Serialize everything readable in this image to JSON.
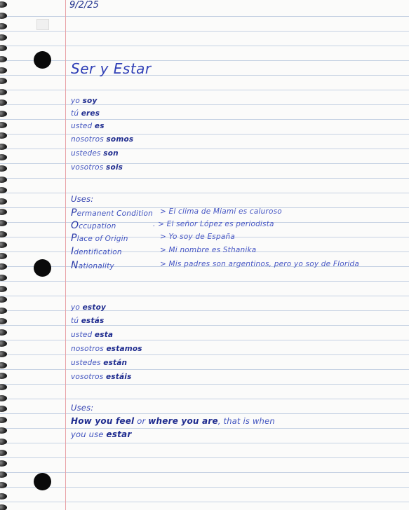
{
  "date": "9/2/25",
  "title": "Ser y Estar",
  "ser_conjugations": [
    {
      "subject": "yo",
      "verb": "soy"
    },
    {
      "subject": "tú",
      "verb": "eres"
    },
    {
      "subject": "usted",
      "verb": "es"
    },
    {
      "subject": "nosotros",
      "verb": "somos"
    },
    {
      "subject": "ustedes",
      "verb": "son"
    },
    {
      "subject": "vosotros",
      "verb": "sois"
    }
  ],
  "ser_uses_heading": "Uses:",
  "ser_uses": [
    {
      "term": "Permanent Condition",
      "example": "> El clima de Miami es caluroso"
    },
    {
      "term": "Occupation",
      "example": ". > El señor López es periodista"
    },
    {
      "term": "Place of Origin",
      "example": "> Yo soy de España"
    },
    {
      "term": "Identification",
      "example": "> Mi nombre es Sthanika"
    },
    {
      "term": "Nationality",
      "example": "> Mis padres son argentinos, pero yo soy de Florida"
    }
  ],
  "estar_conjugations": [
    {
      "subject": "yo",
      "verb": "estoy"
    },
    {
      "subject": "tú",
      "verb": "estás"
    },
    {
      "subject": "usted",
      "verb": "esta"
    },
    {
      "subject": "nosotros",
      "verb": "estamos"
    },
    {
      "subject": "ustedes",
      "verb": "están"
    },
    {
      "subject": "vosotros",
      "verb": "estáis"
    }
  ],
  "estar_uses_heading": "Uses:",
  "estar_use_line1": {
    "p1": "How you feel",
    "p2": " or ",
    "p3": "where you are",
    "p4": ", that is when"
  },
  "estar_use_line2": {
    "p1": "you use ",
    "p2": "estar"
  },
  "colors": {
    "ink": "#3f52bf",
    "bold_ink": "#1f2c8f",
    "margin_line": "#e8a3a8",
    "rule_line": "#c6d2e3"
  }
}
